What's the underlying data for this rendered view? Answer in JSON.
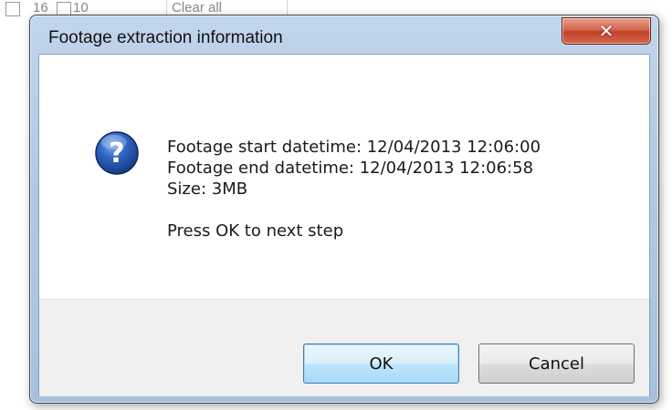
{
  "background": {
    "fragments": [
      "16",
      "10",
      "Clear all"
    ]
  },
  "dialog": {
    "title": "Footage extraction information",
    "close_icon": "close-x-icon",
    "icon": "question-icon",
    "message_lines": [
      "Footage start datetime: 12/04/2013 12:06:00",
      "Footage end datetime: 12/04/2013 12:06:58",
      "Size: 3MB"
    ],
    "prompt": "Press OK to next step",
    "buttons": {
      "ok": "OK",
      "cancel": "Cancel"
    }
  },
  "colors": {
    "accent": "#3c7fb1",
    "close_button": "#c2402a",
    "question_icon": "#1f4f9c"
  }
}
